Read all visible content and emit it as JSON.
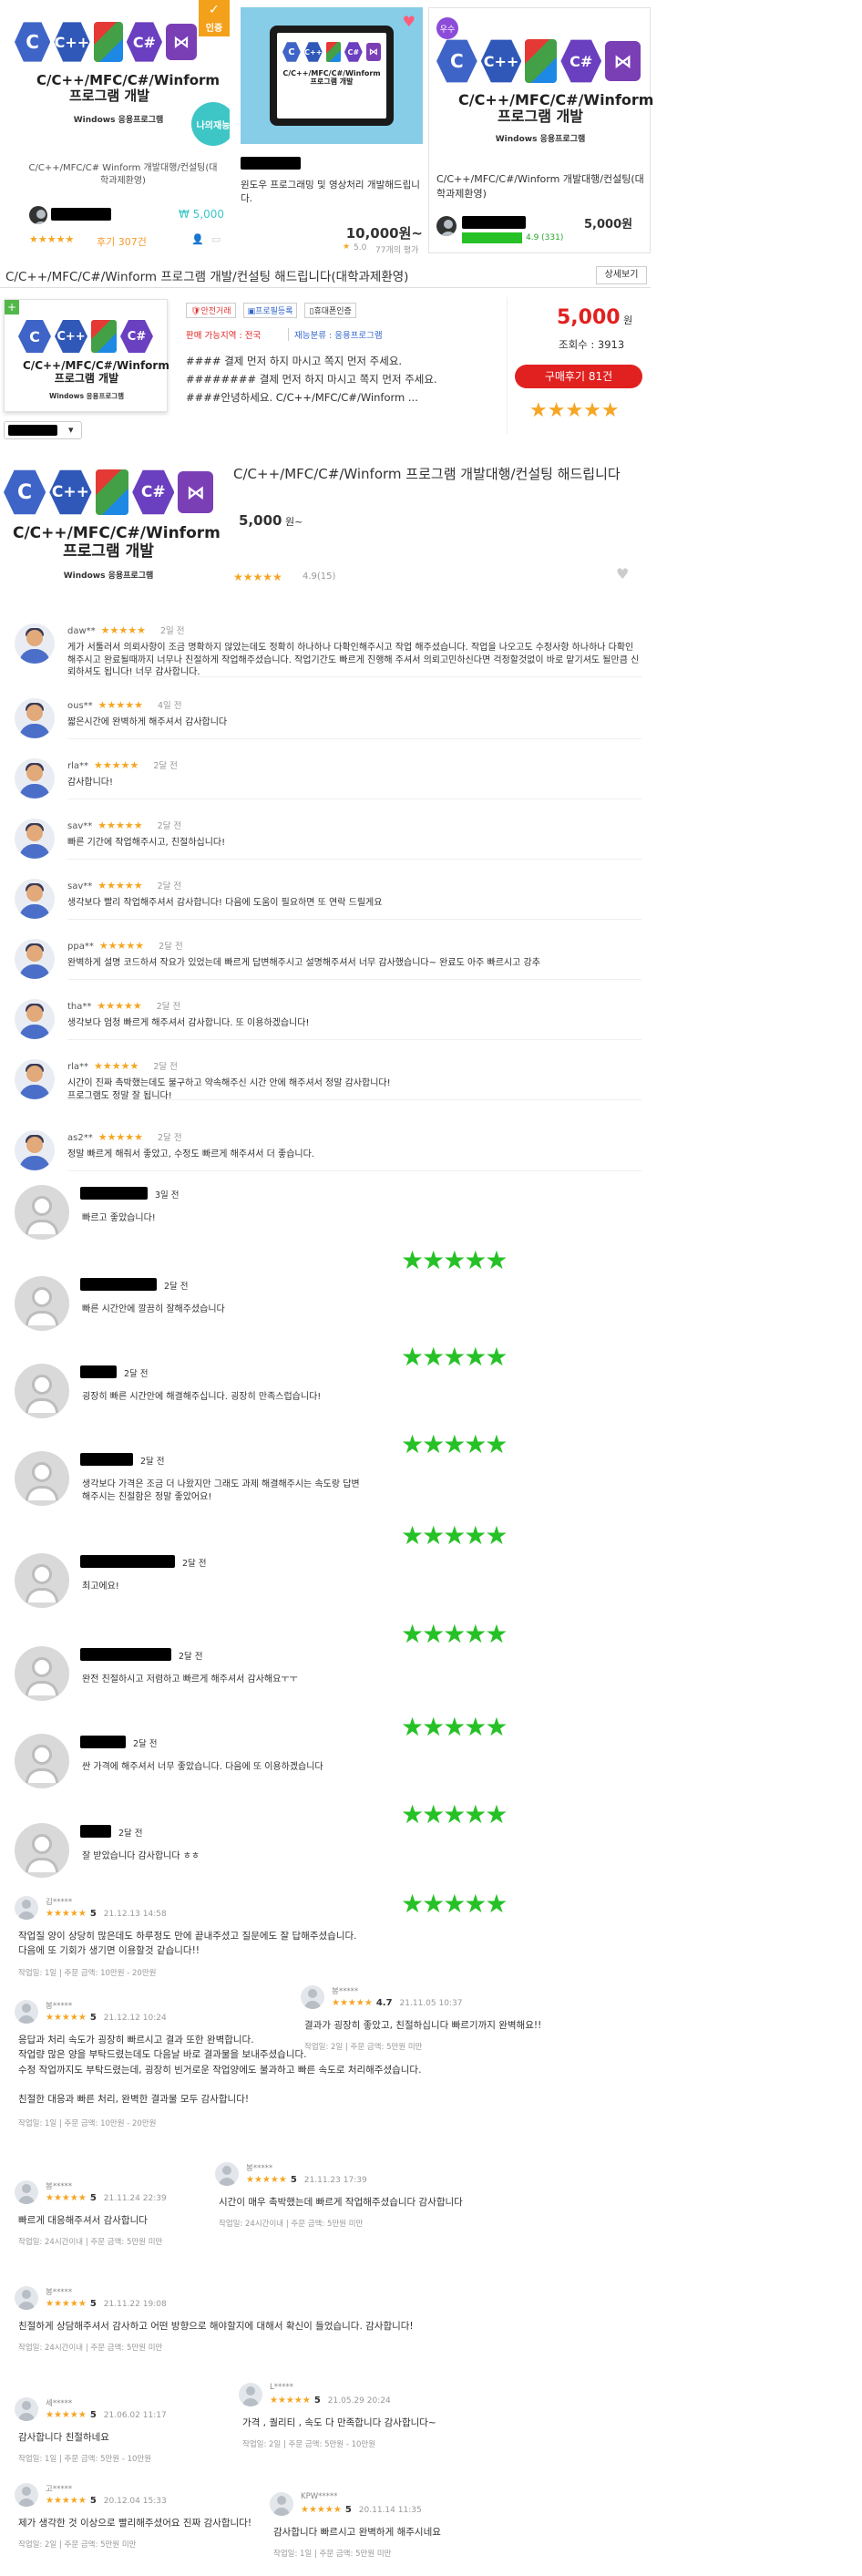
{
  "top_cards": [
    {
      "badge": "인증",
      "logo_title": "C/C++/MFC/C#/Winform\n프로그램 개발",
      "logo_sub": "Windows 응용프로그램",
      "round_badge": "나의재능",
      "title": "C/C++/MFC/C# Winform 개발대행/컨설팅(대학과제환영)",
      "price": "₩ 5,000",
      "stars": "★★★★★",
      "reviews": "후기 307건"
    },
    {
      "tablet_title": "C/C++/MFC/C#/Winform\n프로그램 개발",
      "title": "윈도우 프로그래밍 및 영상처리 개발해드립니다.",
      "price": "10,000원~",
      "rating": "5.0",
      "count": "77개의 평가"
    },
    {
      "badge": "우수",
      "logo_title": "C/C++/MFC/C#/Winform\n프로그램 개발",
      "logo_sub": "Windows 응용프로그램",
      "title": "C/C++/MFC/C#/Winform 개발대행/컨설팅(대학과제환영)",
      "price": "5,000원",
      "rating": "4.9 (331)"
    }
  ],
  "detail": {
    "title": "C/C++/MFC/C#/Winform 프로그램 개발/컨설팅 해드립니다(대학과제환영)",
    "detail_button": "상세보기",
    "badges": [
      "안전거래",
      "프로필등록",
      "휴대폰인증"
    ],
    "area_label": "판매 가능지역 : 전국",
    "category_label": "재능분류 : 응용프로그램",
    "desc_lines": [
      "#### 결제 먼저 하지 마시고 쪽지 먼저 주세요.",
      "######## 결제 먼저 하지 마시고 쪽지 먼저 주세요.",
      "####안녕하세요. C/C++/MFC/C#/Winform ..."
    ],
    "price": "5,000",
    "price_unit": "원",
    "views_label": "조회수 : 3913",
    "review_button": "구매후기 81건",
    "stars": "★★★★★",
    "logo_title": "C/C++/MFC/C#/Winform\n프로그램 개발",
    "logo_sub": "Windows 응용프로그램",
    "select_arrow": "▾"
  },
  "product": {
    "logo_title": "C/C++/MFC/C#/Winform\n프로그램 개발",
    "logo_sub": "Windows 응용프로그램",
    "title": "C/C++/MFC/C#/Winform 프로그램 개발대행/컨설팅 해드립니다",
    "price": "5,000",
    "price_unit": "원~",
    "stars": "★★★★★",
    "rating": "4.9(15)"
  },
  "reviews_a": [
    {
      "name": "daw**",
      "stars": "★★★★★",
      "time": "2일 전",
      "text": "게가 서툴러서 의뢰사항이 조금 명확하지 않았는데도 정확히 하나하나 다확인해주시고 작업 해주셨습니다. 작업을 나오고도 수정사항 하나하나 다확인해주시고 완료될때까지 너무나 친절하게 작업해주셨습니다. 작업기간도 빠르게 진행해 주셔서 의뢰고민하신다면 걱정할것없이 바로 맡기셔도 될만큼 신뢰하셔도 됩니다! 너무 감사합니다."
    },
    {
      "name": "ous**",
      "stars": "★★★★★",
      "time": "4일 전",
      "text": "짧은시간에 완벽하게 해주셔서 감사합니다"
    },
    {
      "name": "rla**",
      "stars": "★★★★★",
      "time": "2달 전",
      "text": "감사합니다!"
    },
    {
      "name": "sav**",
      "stars": "★★★★★",
      "time": "2달 전",
      "text": "빠른 기간에 작업해주시고, 친절하십니다!"
    },
    {
      "name": "sav**",
      "stars": "★★★★★",
      "time": "2달 전",
      "text": "생각보다 빨리 작업해주셔서 감사합니다! 다음에 도움이 필요하면 또 연락 드릴게요"
    },
    {
      "name": "ppa**",
      "stars": "★★★★★",
      "time": "2달 전",
      "text": "완벽하게 설명 코드하셔 작요가 있었는데 빠르게 답변해주시고 설명해주셔서 너무 감사했습니다~ 완료도 아주 빠르시고 강추"
    },
    {
      "name": "tha**",
      "stars": "★★★★★",
      "time": "2달 전",
      "text": "생각보다 엄청 빠르게 해주셔서 감사합니다. 또 이용하겠습니다!"
    },
    {
      "name": "rla**",
      "stars": "★★★★★",
      "time": "2달 전",
      "text": "시간이 진짜 촉박했는데도 불구하고 약속해주신 시간 안에 해주셔서 정말 감사합니다!\n프로그램도 정말 잘 됩니다!"
    },
    {
      "name": "as2**",
      "stars": "★★★★★",
      "time": "2달 전",
      "text": "정말 빠르게 해줘서 좋았고, 수정도 빠르게 해주셔서 더 좋습니다."
    }
  ],
  "reviews_b": [
    {
      "time": "3일 전",
      "text": "빠르고 좋았습니다!",
      "stars": "★★★★★"
    },
    {
      "time": "2달 전",
      "text": "빠른 시간안에 깔끔히 잘해주셨습니다",
      "stars": "★★★★★"
    },
    {
      "time": "2달 전",
      "text": "굉장히 빠른 시간안에 해결해주십니다. 굉장히 만족스럽습니다!",
      "stars": "★★★★★"
    },
    {
      "time": "2달 전",
      "text": "생각보다 가격은 조금 더 나왔지만 그래도 과제 해결해주시는 속도랑 답변\n해주시는 친절함은 정말 좋았어요!",
      "stars": "★★★★★"
    },
    {
      "time": "2달 전",
      "text": "최고에요!",
      "stars": "★★★★★"
    },
    {
      "time": "2달 전",
      "text": "완전 친절하시고 저렴하고 빠르게 해주셔서 감사해요ㅜㅜ",
      "stars": "★★★★★"
    },
    {
      "time": "2달 전",
      "text": "싼 가격에 해주셔서 너무 좋았습니다. 다음에 또 이용하겠습니다",
      "stars": "★★★★★"
    },
    {
      "time": "2달 전",
      "text": "잘 받았습니다 감사합니다 ㅎㅎ",
      "stars": "★★★★★"
    }
  ],
  "reviews_c": [
    {
      "name": "김*****",
      "stars": "★★★★★",
      "score": "5",
      "date": "21.12.13 14:58",
      "text": "작업질 양이 상당히 많은데도 하루정도 만에 끝내주셨고 질문에도 잘 답해주셨습니다.\n다음에 또 기회가 생기면 이용할것 같습니다!!",
      "meta": "작업일: 1일 | 주문 금액: 10만원 - 20만원"
    },
    {
      "name": "봉*****",
      "stars": "★★★★★",
      "score": "4.7",
      "date": "21.11.05 10:37",
      "text": "결과가 굉장히 좋았고, 친절하십니다 빠르기까지 완벽해요!!",
      "meta": "작업일: 2일 | 주문 금액: 5만원 미만"
    },
    {
      "name": "봉*****",
      "stars": "★★★★★",
      "score": "5",
      "date": "21.12.12 10:24",
      "text": "응답과 처리 속도가 굉장히 빠르시고 결과 또한 완벽합니다.\n작업량 많은 양을 부탁드렸는데도 다음날 바로 결과물을 보내주셨습니다.\n수정 작업까지도 부탁드렸는데, 굉장히 빈거로운 작업양에도 불과하고 빠른 속도로 처리해주셨습니다.\n\n친절한 대응과 빠른 처리, 완벽한 결과물 모두 감사합니다!",
      "meta": "작업일: 1일 | 주문 금액: 10만원 - 20만원"
    },
    {
      "name": "봉*****",
      "stars": "★★★★★",
      "score": "5",
      "date": "21.11.23 17:39",
      "text": "시간이 매우 촉박했는데 빠르게 작업해주셨습니다 감사합니다",
      "meta": "작업일: 24시간이내 | 주문 금액: 5만원 미만"
    },
    {
      "name": "봉*****",
      "stars": "★★★★★",
      "score": "5",
      "date": "21.11.24 22:39",
      "text": "빠르게 대응해주셔서 감사합니다",
      "meta": "작업일: 24시간이내 | 주문 금액: 5만원 미만"
    },
    {
      "name": "봉*****",
      "stars": "★★★★★",
      "score": "5",
      "date": "21.11.22 19:08",
      "text": "친절하게 상담해주셔서 감사하고 어떤 방향으로 해야할지에 대해서 확신이 들었습니다. 감사합니다!",
      "meta": "작업일: 24시간이내 | 주문 금액: 5만원 미만"
    },
    {
      "name": "세*****",
      "stars": "★★★★★",
      "score": "5",
      "date": "21.06.02 11:17",
      "text": "감사합니다 친절하네요",
      "meta": "작업일: 1일 | 주문 금액: 5만원 - 10만원"
    },
    {
      "name": "L*****",
      "stars": "★★★★★",
      "score": "5",
      "date": "21.05.29 20:24",
      "text": "가격 , 퀄리티 , 속도 다 만족합니다 감사합니다~",
      "meta": "작업일: 2일 | 주문 금액: 5만원 - 10만원"
    },
    {
      "name": "고*****",
      "stars": "★★★★★",
      "score": "5",
      "date": "20.12.04 15:33",
      "text": "제가 생각한 것 이상으로 빨리해주셨어요 진짜 감사합니다!",
      "meta": "작업일: 2일 | 주문 금액: 5만원 미만"
    },
    {
      "name": "KPW*****",
      "stars": "★★★★★",
      "score": "5",
      "date": "20.11.14 11:35",
      "text": "감사합니다 빠르시고 완벽하게 해주시네요",
      "meta": "작업일: 1일 | 주문 금액: 5만원 미만"
    }
  ],
  "colors": {
    "price_red": "#e0211f",
    "star_orange": "#f5a623",
    "star_green": "#26c126",
    "accent_blue": "#3f64c8",
    "teal": "#3ec6c6"
  }
}
